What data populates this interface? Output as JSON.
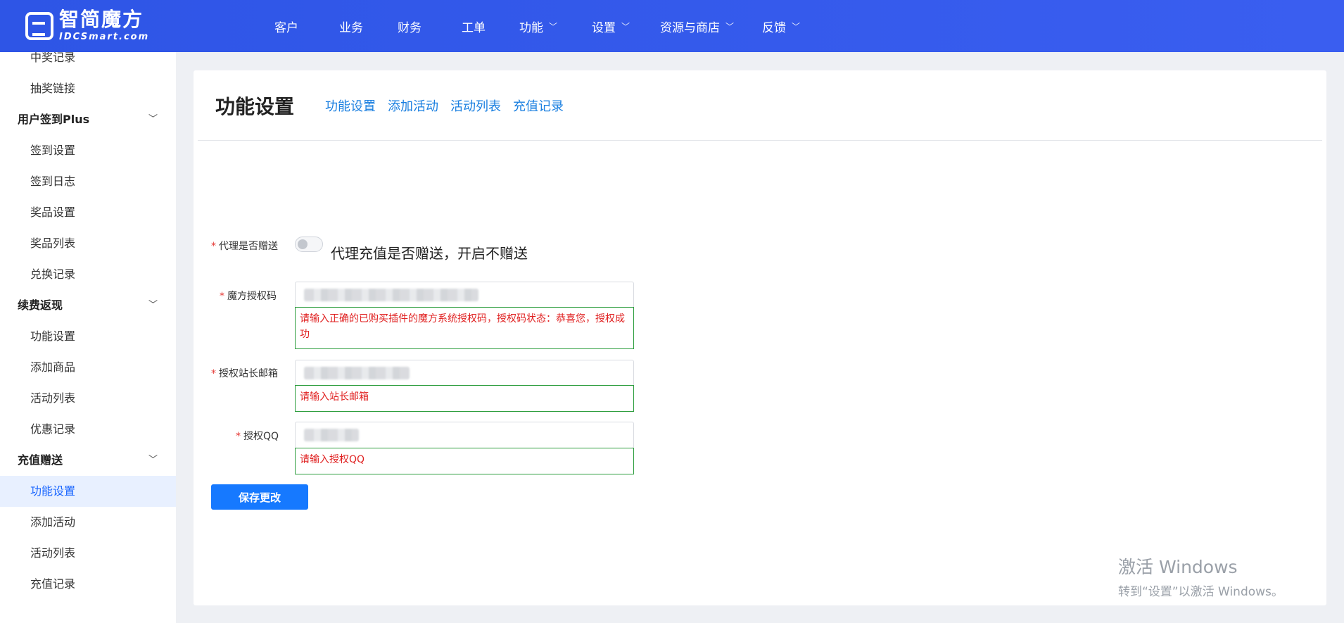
{
  "brand": {
    "name_cn": "智简魔方",
    "name_en": "IDCSmart.com"
  },
  "nav": {
    "items": [
      {
        "label": "客户",
        "dropdown": false
      },
      {
        "label": "业务",
        "dropdown": false
      },
      {
        "label": "财务",
        "dropdown": false
      },
      {
        "label": "工单",
        "dropdown": false
      },
      {
        "label": "功能",
        "dropdown": true
      },
      {
        "label": "设置",
        "dropdown": true
      },
      {
        "label": "资源与商店",
        "dropdown": true
      },
      {
        "label": "反馈",
        "dropdown": true
      }
    ],
    "chevron": "﹀"
  },
  "sidebar": {
    "items": [
      {
        "type": "sub",
        "label": "中奖记录"
      },
      {
        "type": "sub",
        "label": "抽奖链接"
      },
      {
        "type": "group",
        "label": "用户签到Plus"
      },
      {
        "type": "sub",
        "label": "签到设置"
      },
      {
        "type": "sub",
        "label": "签到日志"
      },
      {
        "type": "sub",
        "label": "奖品设置"
      },
      {
        "type": "sub",
        "label": "奖品列表"
      },
      {
        "type": "sub",
        "label": "兑换记录"
      },
      {
        "type": "group",
        "label": "续费返现"
      },
      {
        "type": "sub",
        "label": "功能设置"
      },
      {
        "type": "sub",
        "label": "添加商品"
      },
      {
        "type": "sub",
        "label": "活动列表"
      },
      {
        "type": "sub",
        "label": "优惠记录"
      },
      {
        "type": "group",
        "label": "充值赠送"
      },
      {
        "type": "sub",
        "label": "功能设置",
        "active": true
      },
      {
        "type": "sub",
        "label": "添加活动"
      },
      {
        "type": "sub",
        "label": "活动列表"
      },
      {
        "type": "sub",
        "label": "充值记录"
      }
    ]
  },
  "main": {
    "title": "功能设置",
    "tabs": [
      "功能设置",
      "添加活动",
      "活动列表",
      "充值记录"
    ],
    "form": {
      "agent_gift": {
        "label": "代理是否赠送",
        "description": "代理充值是否赠送，开启不赠送",
        "enabled": false
      },
      "auth_code": {
        "label": "魔方授权码",
        "hint": "请输入正确的已购买插件的魔方系统授权码，授权码状态：恭喜您，授权成功"
      },
      "auth_email": {
        "label": "授权站长邮箱",
        "hint": "请输入站长邮箱"
      },
      "auth_qq": {
        "label": "授权QQ",
        "hint": "请输入授权QQ"
      },
      "required_mark": "*",
      "save_label": "保存更改"
    }
  },
  "watermark": {
    "line1": "激活 Windows",
    "line2": "转到“设置”以激活 Windows。"
  },
  "colors": {
    "topbar": "#2f54eb",
    "link": "#1a7fe0",
    "error": "#e02020",
    "hint_border": "#2e9e3f",
    "primary_button": "#1679ff"
  }
}
